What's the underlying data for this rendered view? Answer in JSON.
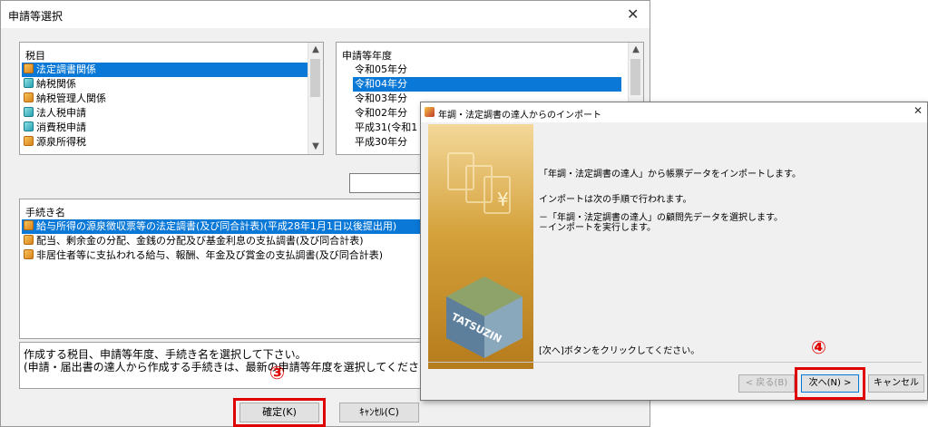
{
  "dialog1": {
    "title": "申請等選択",
    "tax_list": {
      "header": "税目",
      "items": [
        {
          "label": "法定調書関係",
          "selected": true,
          "icon": "orange-doc-icon"
        },
        {
          "label": "納税関係",
          "selected": false,
          "icon": "teal-doc-icon"
        },
        {
          "label": "納税管理人関係",
          "selected": false,
          "icon": "orange-doc-icon"
        },
        {
          "label": "法人税申請",
          "selected": false,
          "icon": "teal-doc-icon"
        },
        {
          "label": "消費税申請",
          "selected": false,
          "icon": "teal-doc-icon"
        },
        {
          "label": "源泉所得税",
          "selected": false,
          "icon": "orange-doc-icon"
        }
      ]
    },
    "year_list": {
      "header": "申請等年度",
      "items": [
        {
          "label": "令和05年分",
          "selected": false
        },
        {
          "label": "令和04年分",
          "selected": true
        },
        {
          "label": "令和03年分",
          "selected": false
        },
        {
          "label": "令和02年分",
          "selected": false
        },
        {
          "label": "平成31(令和1",
          "selected": false
        },
        {
          "label": "平成30年分",
          "selected": false
        }
      ]
    },
    "proc_list": {
      "header": "手続き名",
      "items": [
        {
          "label": "給与所得の源泉徴収票等の法定調書(及び同合計表)(平成28年1月1日以後提出用)",
          "selected": true
        },
        {
          "label": "配当、剰余金の分配、金銭の分配及び基金利息の支払調書(及び同合計表)",
          "selected": false
        },
        {
          "label": "非居住者等に支払われる給与、報酬、年金及び賞金の支払調書(及び同合計表)",
          "selected": false
        }
      ]
    },
    "info_line1": "作成する税目、申請等年度、手続き名を選択して下さい。",
    "info_line2": "(申請・届出書の達人から作成する手続きは、最新の申請等年度を選択してください)",
    "ok_label": "確定(K)",
    "cancel_label": "ｷｬﾝｾﾙ(C)",
    "step_marker": "③"
  },
  "dialog2": {
    "title": "年調・法定調書の達人からのインポート",
    "line1": "「年調・法定調書の達人」から帳票データをインポートします。",
    "line2": "インポートは次の手順で行われます。",
    "line3": "－「年調・法定調書の達人」の顧問先データを選択します。",
    "line4": "－インポートを実行します。",
    "line5": "[次へ]ボタンをクリックしてください。",
    "back_label": "< 戻る(B)",
    "next_label": "次へ(N) >",
    "cancel_label": "キャンセル",
    "banner_text": "TATSUZIN",
    "step_marker": "④"
  },
  "colors": {
    "selection": "#0a78d7",
    "highlight": "#e00000"
  }
}
